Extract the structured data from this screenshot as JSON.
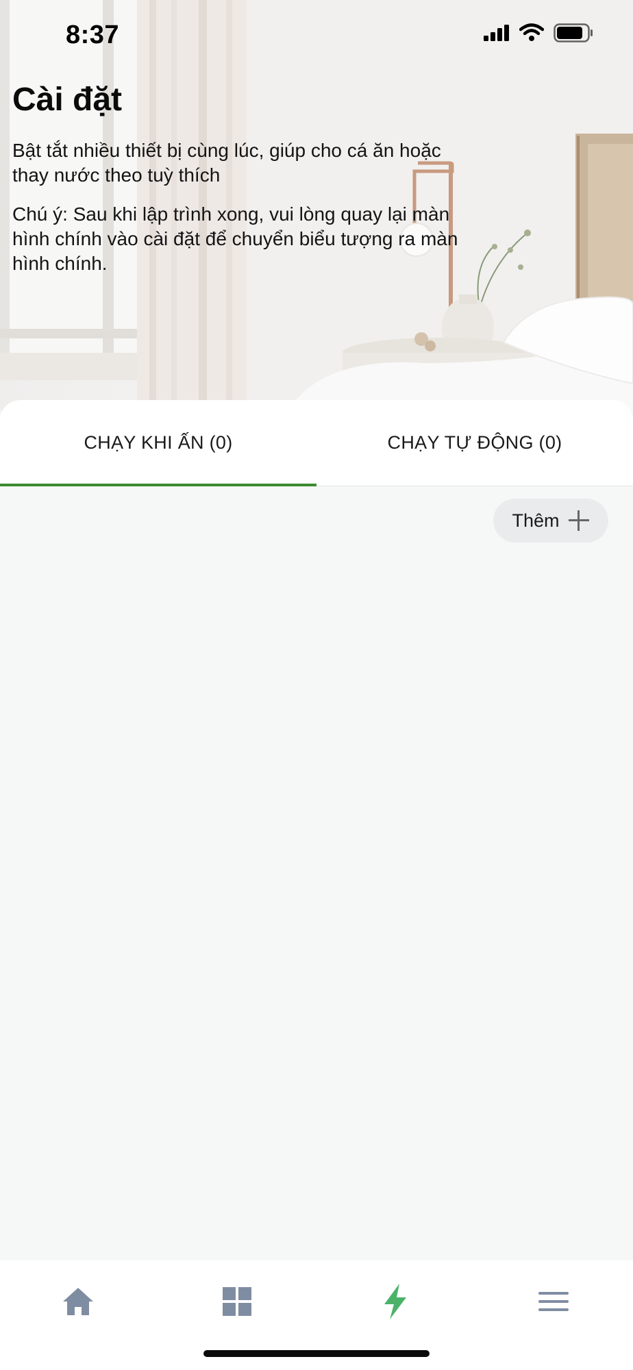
{
  "status_bar": {
    "time": "8:37"
  },
  "header": {
    "title": "Cài đặt",
    "description": "Bật tắt nhiều thiết bị cùng lúc, giúp cho cá ăn hoặc thay nước theo tuỳ thích",
    "note": "Chú ý: Sau khi lập trình xong, vui lòng quay lại màn hình chính vào cài đặt để chuyển biểu tượng ra màn hình chính."
  },
  "tabs": [
    {
      "label": "CHẠY KHI ẤN (0)",
      "active": true
    },
    {
      "label": "CHẠY TỰ ĐỘNG (0)",
      "active": false
    }
  ],
  "actions": {
    "add_label": "Thêm",
    "add_icon": "plus-icon"
  },
  "bottom_nav": {
    "items": [
      {
        "icon": "home-icon",
        "active": false
      },
      {
        "icon": "grid-icon",
        "active": false
      },
      {
        "icon": "lightning-icon",
        "active": true
      },
      {
        "icon": "menu-icon",
        "active": false
      }
    ]
  },
  "colors": {
    "accent_green": "#3c8a2e",
    "active_icon": "#4cb26a",
    "inactive_icon": "#7f8da2"
  }
}
